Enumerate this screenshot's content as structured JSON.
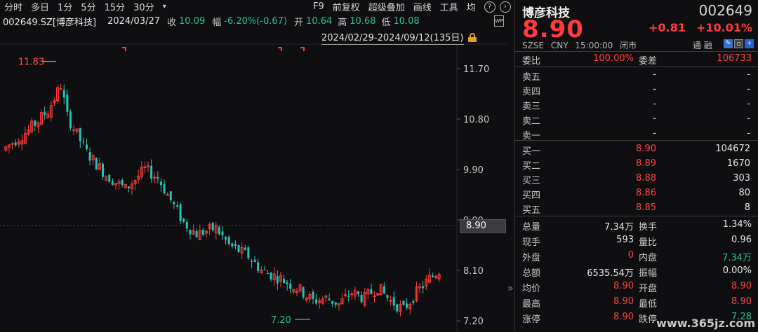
{
  "toolbar": {
    "periods": [
      "分时",
      "多日",
      "1分",
      "5分",
      "15分",
      "30分",
      "▾"
    ],
    "tools": [
      "F9",
      "前复权",
      "超级叠加",
      "画线",
      "工具",
      "均"
    ],
    "help_icon": "question-circle-icon",
    "next_icon": "chevron-right-icon"
  },
  "info": {
    "symbol": "002649.SZ[博彦科技]",
    "date": "2024/03/27",
    "close_label": "收",
    "close": "10.09",
    "change_label": "幅",
    "change": "-6.20%(-0.67)",
    "open_label": "开",
    "open": "10.64",
    "high_label": "高",
    "high": "10.68",
    "low_label": "低",
    "low": "10.08"
  },
  "range": {
    "text": "2024/02/29-2024/09/12(135日)"
  },
  "wp_icon": "WP",
  "chart": {
    "price_tag": "8.90",
    "max_label": "11.83",
    "min_label": "7.20",
    "y_ticks": [
      "11.70",
      "10.80",
      "9.90",
      "9.00",
      "8.10",
      "7.20"
    ]
  },
  "quote": {
    "name": "博彦科技",
    "code": "002649",
    "price": "8.90",
    "change": "+0.81",
    "pct": "+10.01%",
    "meta": [
      "SZSE",
      "CNY",
      "15:00:00",
      "闭市"
    ],
    "tong": "通 融",
    "weibi_label": "委比",
    "weibi": "100.00%",
    "weicha_label": "委差",
    "weicha": "106733",
    "asks": [
      {
        "label": "卖五",
        "price": "-",
        "vol": "-"
      },
      {
        "label": "卖四",
        "price": "-",
        "vol": "-"
      },
      {
        "label": "卖三",
        "price": "-",
        "vol": "-"
      },
      {
        "label": "卖二",
        "price": "-",
        "vol": "-"
      },
      {
        "label": "卖一",
        "price": "-",
        "vol": "-"
      }
    ],
    "bids": [
      {
        "label": "买一",
        "price": "8.90",
        "vol": "104672"
      },
      {
        "label": "买二",
        "price": "8.89",
        "vol": "1670"
      },
      {
        "label": "买三",
        "price": "8.88",
        "vol": "303"
      },
      {
        "label": "买四",
        "price": "8.86",
        "vol": "80"
      },
      {
        "label": "买五",
        "price": "8.85",
        "vol": "8"
      }
    ],
    "stats": [
      {
        "l1": "总量",
        "v1": "7.34万",
        "l2": "换手",
        "v2": "1.34%",
        "c1": "white",
        "c2": "white"
      },
      {
        "l1": "现手",
        "v1": "593",
        "l2": "量比",
        "v2": "0.96",
        "c1": "white",
        "c2": "white"
      },
      {
        "l1": "外盘",
        "v1": "0",
        "l2": "内盘",
        "v2": "7.34万",
        "c1": "red",
        "c2": "grn"
      },
      {
        "l1": "总额",
        "v1": "6535.54万",
        "l2": "振幅",
        "v2": "0.00%",
        "c1": "white",
        "c2": "white"
      },
      {
        "l1": "均价",
        "v1": "8.90",
        "l2": "开盘",
        "v2": "8.90",
        "c1": "red",
        "c2": "red"
      },
      {
        "l1": "最高",
        "v1": "8.90",
        "l2": "最低",
        "v2": "8.90",
        "c1": "red",
        "c2": "red"
      },
      {
        "l1": "涨停",
        "v1": "8.90",
        "l2": "跌停",
        "v2": "7.28",
        "c1": "red",
        "c2": "grn"
      }
    ]
  },
  "watermark": "www.365jz.com",
  "colors": {
    "up": "#ff3b3b",
    "down": "#23c4b4",
    "bg": "#0f0f12"
  }
}
